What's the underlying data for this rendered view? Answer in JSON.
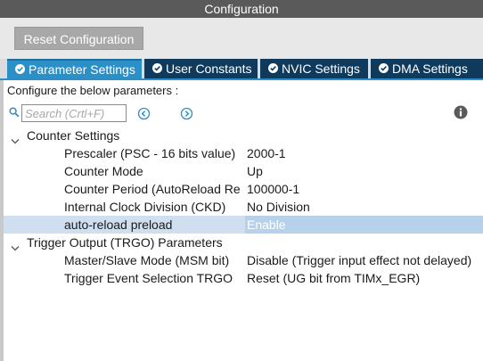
{
  "window": {
    "title": "Configuration"
  },
  "toolbar": {
    "reset_label": "Reset Configuration"
  },
  "tabs": [
    {
      "label": "Parameter Settings",
      "active": true
    },
    {
      "label": "User Constants",
      "active": false
    },
    {
      "label": "NVIC Settings",
      "active": false
    },
    {
      "label": "DMA Settings",
      "active": false
    }
  ],
  "panel": {
    "instruction": "Configure the below parameters :",
    "search": {
      "placeholder": "Search (Crtl+F)",
      "value": ""
    }
  },
  "groups": [
    {
      "label": "Counter Settings",
      "params": [
        {
          "name": "Prescaler (PSC - 16 bits value)",
          "value": "2000-1"
        },
        {
          "name": "Counter Mode",
          "value": "Up"
        },
        {
          "name": "Counter Period (AutoReload Reg...",
          "value": "100000-1"
        },
        {
          "name": "Internal Clock Division (CKD)",
          "value": "No Division"
        },
        {
          "name": "auto-reload preload",
          "value": "Enable",
          "selected": true
        }
      ]
    },
    {
      "label": "Trigger Output (TRGO) Parameters",
      "params": [
        {
          "name": "Master/Slave Mode (MSM bit)",
          "value": "Disable (Trigger input effect not delayed)"
        },
        {
          "name": "Trigger Event Selection TRGO",
          "value": "Reset (UG bit from TIMx_EGR)"
        }
      ]
    }
  ],
  "colors": {
    "tab_active": "#2b8fc8",
    "tab_inactive": "#0f3a5c",
    "selected_row": "#cfdff0",
    "nav_icon": "#2b8fc8"
  }
}
